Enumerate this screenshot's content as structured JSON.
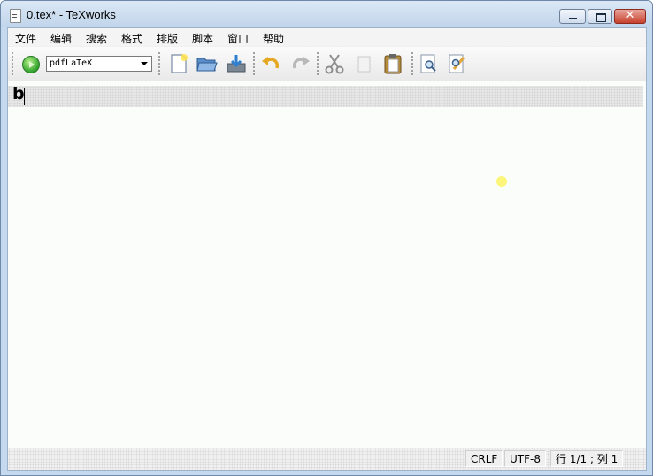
{
  "window": {
    "title": "0.tex* - TeXworks",
    "close_glyph": "✕"
  },
  "menubar": {
    "items": [
      "文件",
      "编辑",
      "搜索",
      "格式",
      "排版",
      "脚本",
      "窗口",
      "帮助"
    ]
  },
  "toolbar": {
    "typeset_icon": "play-icon",
    "engine": "pdfLaTeX",
    "tools": [
      "new-file-icon",
      "open-folder-icon",
      "save-icon",
      "undo-icon",
      "redo-icon",
      "cut-icon",
      "copy-icon",
      "paste-icon",
      "find-icon",
      "replace-icon"
    ]
  },
  "editor": {
    "content": "b"
  },
  "status": {
    "line_ending": "CRLF",
    "encoding": "UTF-8",
    "position": "行 1/1 ; 列 1"
  },
  "colors": {
    "titlebar": "#c8dbef",
    "close_button": "#c7402d",
    "typeset_green": "#2fa12c",
    "current_line": "#e7e7e7"
  }
}
